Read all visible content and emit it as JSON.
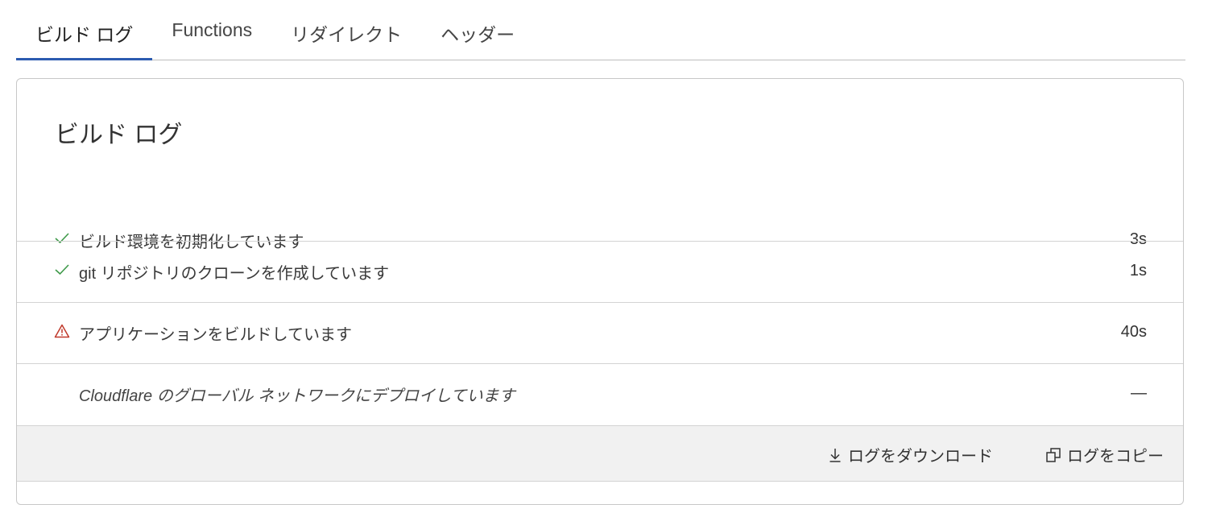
{
  "tabs": [
    {
      "label": "ビルド ログ",
      "active": true
    },
    {
      "label": "Functions",
      "active": false
    },
    {
      "label": "リダイレクト",
      "active": false
    },
    {
      "label": "ヘッダー",
      "active": false
    }
  ],
  "card": {
    "title": "ビルド ログ"
  },
  "steps": [
    {
      "status": "success",
      "icon": "check-icon",
      "label": "ビルド環境を初期化しています",
      "duration": "3s"
    },
    {
      "status": "success",
      "icon": "check-icon",
      "label": "git リポジトリのクローンを作成しています",
      "duration": "1s"
    },
    {
      "status": "warning",
      "icon": "warning-icon",
      "label": "アプリケーションをビルドしています",
      "duration": "40s"
    },
    {
      "status": "pending",
      "icon": "",
      "label": "Cloudflare のグローバル ネットワークにデプロイしています",
      "duration": "—"
    }
  ],
  "footer": {
    "download_label": "ログをダウンロード",
    "copy_label": "ログをコピー"
  },
  "colors": {
    "accent": "#2c5bb0",
    "success": "#3f9a4a",
    "warning": "#c0392b",
    "footer_bg": "#f1f1f1"
  }
}
